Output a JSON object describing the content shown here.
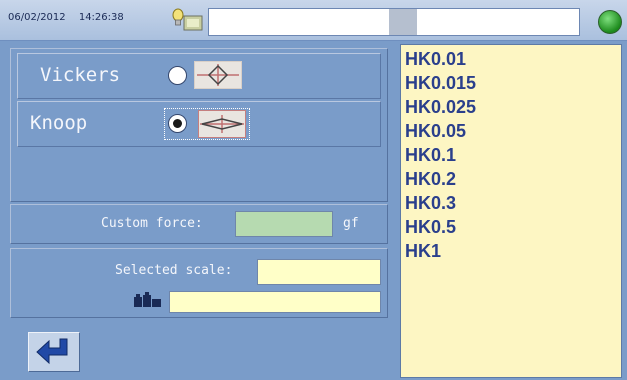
{
  "header": {
    "date": "06/02/2012",
    "time": "14:26:38",
    "message": ""
  },
  "colors": {
    "background": "#7a9cc9",
    "list_background": "#fdf6c3",
    "list_text": "#2a3f8c",
    "status_led": "#2ecc40",
    "custom_force_field": "#b6dab0",
    "selected_scale_field": "#ffffc8"
  },
  "method": {
    "options": [
      {
        "label": "Vickers",
        "selected": false,
        "icon": "vickers-indenter-icon"
      },
      {
        "label": "Knoop",
        "selected": true,
        "icon": "knoop-indenter-icon"
      }
    ]
  },
  "custom_force": {
    "label": "Custom force:",
    "value": "",
    "unit": "gf"
  },
  "selected_scale": {
    "label": "Selected scale:",
    "value": "",
    "weight_value": "",
    "weight_icon": "weights-icon"
  },
  "back_icon": "back-arrow-icon",
  "scales": [
    "HK0.01",
    "HK0.015",
    "HK0.025",
    "HK0.05",
    "HK0.1",
    "HK0.2",
    "HK0.3",
    "HK0.5",
    "HK1"
  ]
}
